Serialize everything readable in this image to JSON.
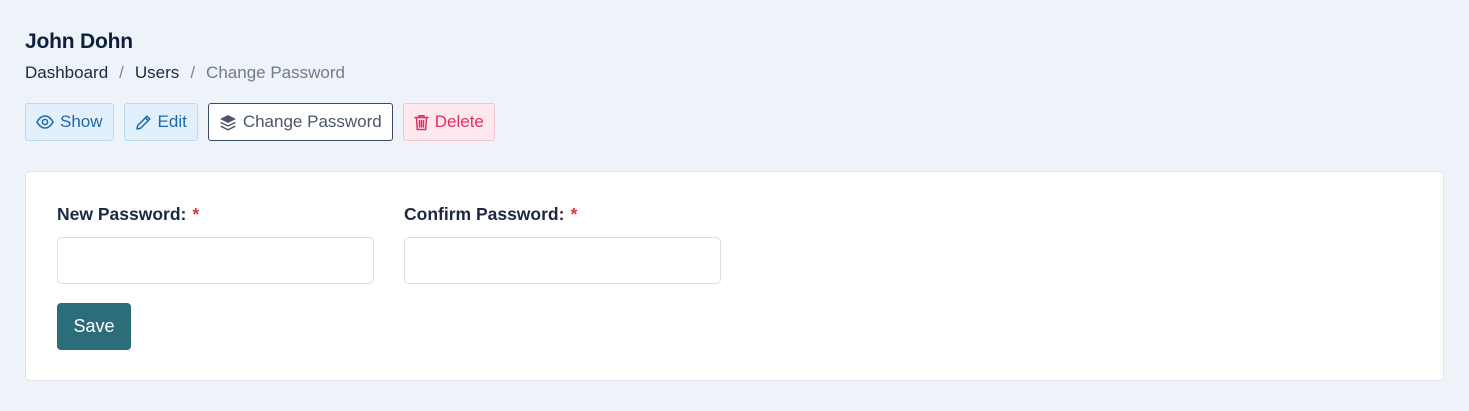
{
  "header": {
    "title": "John Dohn",
    "breadcrumb": [
      {
        "label": "Dashboard"
      },
      {
        "label": "Users"
      },
      {
        "label": "Change Password"
      }
    ],
    "separator": "/"
  },
  "actions": {
    "show": {
      "label": "Show",
      "icon": "eye-icon"
    },
    "edit": {
      "label": "Edit",
      "icon": "pencil-icon"
    },
    "change_password": {
      "label": "Change Password",
      "icon": "layers-icon"
    },
    "delete": {
      "label": "Delete",
      "icon": "trash-icon"
    }
  },
  "form": {
    "new_password": {
      "label": "New Password:",
      "required_mark": "*",
      "value": ""
    },
    "confirm_password": {
      "label": "Confirm Password:",
      "required_mark": "*",
      "value": ""
    },
    "save_label": "Save"
  },
  "colors": {
    "background": "#eef2f9",
    "primary": "#2b6e7a",
    "info": "#1f6aa6",
    "danger": "#e0305f",
    "required": "#d23b3b"
  }
}
